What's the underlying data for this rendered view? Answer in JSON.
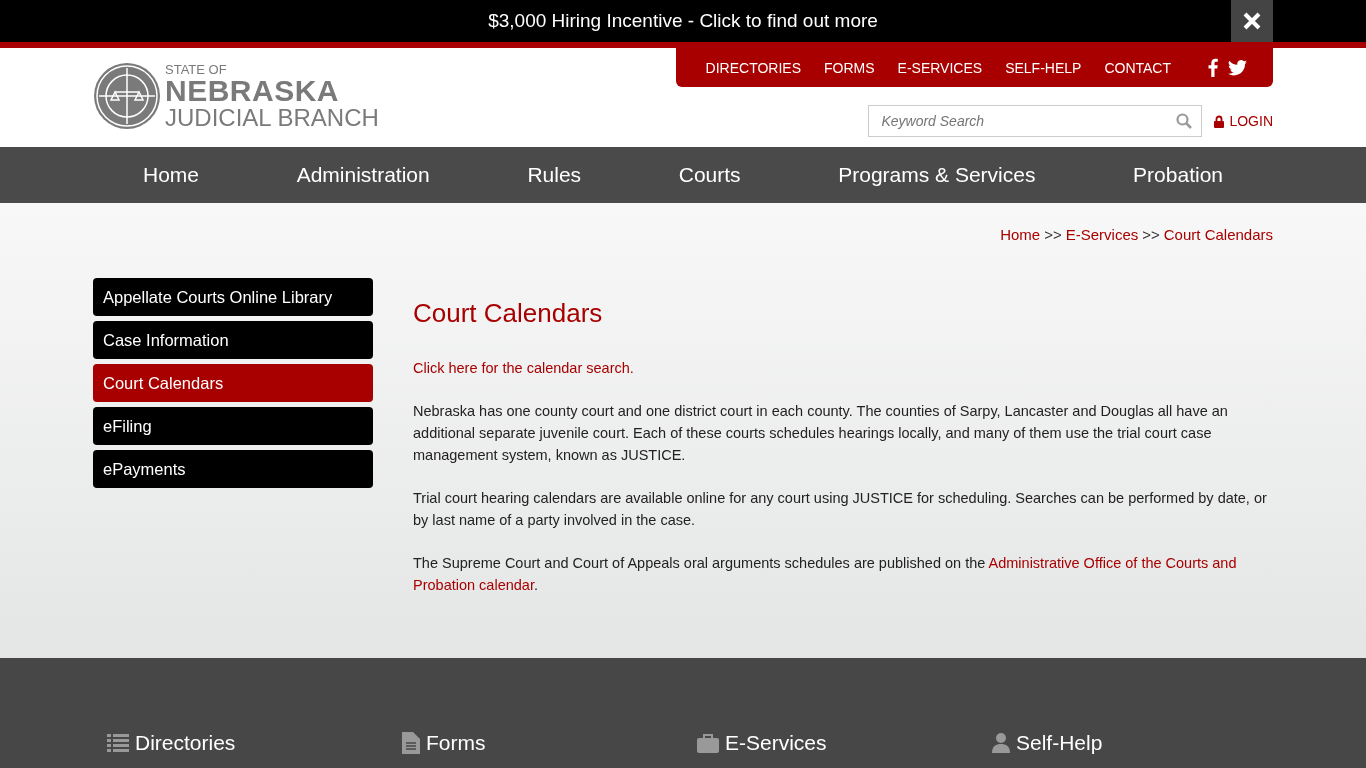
{
  "banner": {
    "text": "$3,000 Hiring Incentive - Click to find out more"
  },
  "utility_nav": [
    "DIRECTORIES",
    "FORMS",
    "E-SERVICES",
    "SELF-HELP",
    "CONTACT"
  ],
  "logo": {
    "line1": "STATE OF",
    "line2": "NEBRASKA",
    "line3": "JUDICIAL BRANCH"
  },
  "search": {
    "placeholder": "Keyword Search"
  },
  "login": "LOGIN",
  "main_nav": [
    "Home",
    "Administration",
    "Rules",
    "Courts",
    "Programs & Services",
    "Probation"
  ],
  "breadcrumb": [
    {
      "text": "Home",
      "kind": "link"
    },
    {
      "text": ">>",
      "kind": "sep"
    },
    {
      "text": "E-Services",
      "kind": "link"
    },
    {
      "text": ">>",
      "kind": "sep"
    },
    {
      "text": "Court Calendars",
      "kind": "link"
    }
  ],
  "sidebar": {
    "items": [
      {
        "label": "Appellate Courts Online Library",
        "selected": false
      },
      {
        "label": "Case Information",
        "selected": false
      },
      {
        "label": "Court Calendars",
        "selected": true
      },
      {
        "label": "eFiling",
        "selected": false
      },
      {
        "label": "ePayments",
        "selected": false
      }
    ]
  },
  "content": {
    "title": "Court Calendars",
    "paragraphs": [
      {
        "parts": [
          {
            "text": "Click here for the calendar search.",
            "link": true
          }
        ]
      },
      {
        "parts": [
          {
            "text": "Nebraska has one county court and one district court in each county.  The counties of Sarpy, Lancaster and Douglas all have an additional separate juvenile court.  Each of these courts schedules hearings locally, and many of them use the trial court case management system, known as JUSTICE.",
            "link": false
          }
        ]
      },
      {
        "parts": [
          {
            "text": "Trial court hearing calendars are available online for any court using JUSTICE for scheduling.  Searches can be performed by date, or by last name of a party involved in the case.",
            "link": false
          }
        ]
      },
      {
        "parts": [
          {
            "text": "The Supreme Court and Court of Appeals oral arguments schedules are published on the ",
            "link": false
          },
          {
            "text": "Administrative Office of the Courts and",
            "link": true
          },
          {
            "text": "Probation calendar",
            "link": true
          },
          {
            "text": ".",
            "link": false
          }
        ]
      }
    ]
  },
  "footer": {
    "columns": [
      {
        "title": "Directories",
        "kind": "list"
      },
      {
        "title": "Forms",
        "kind": "doc"
      },
      {
        "title": "E-Services",
        "kind": "case"
      },
      {
        "title": "Self-Help",
        "kind": "person"
      }
    ]
  }
}
